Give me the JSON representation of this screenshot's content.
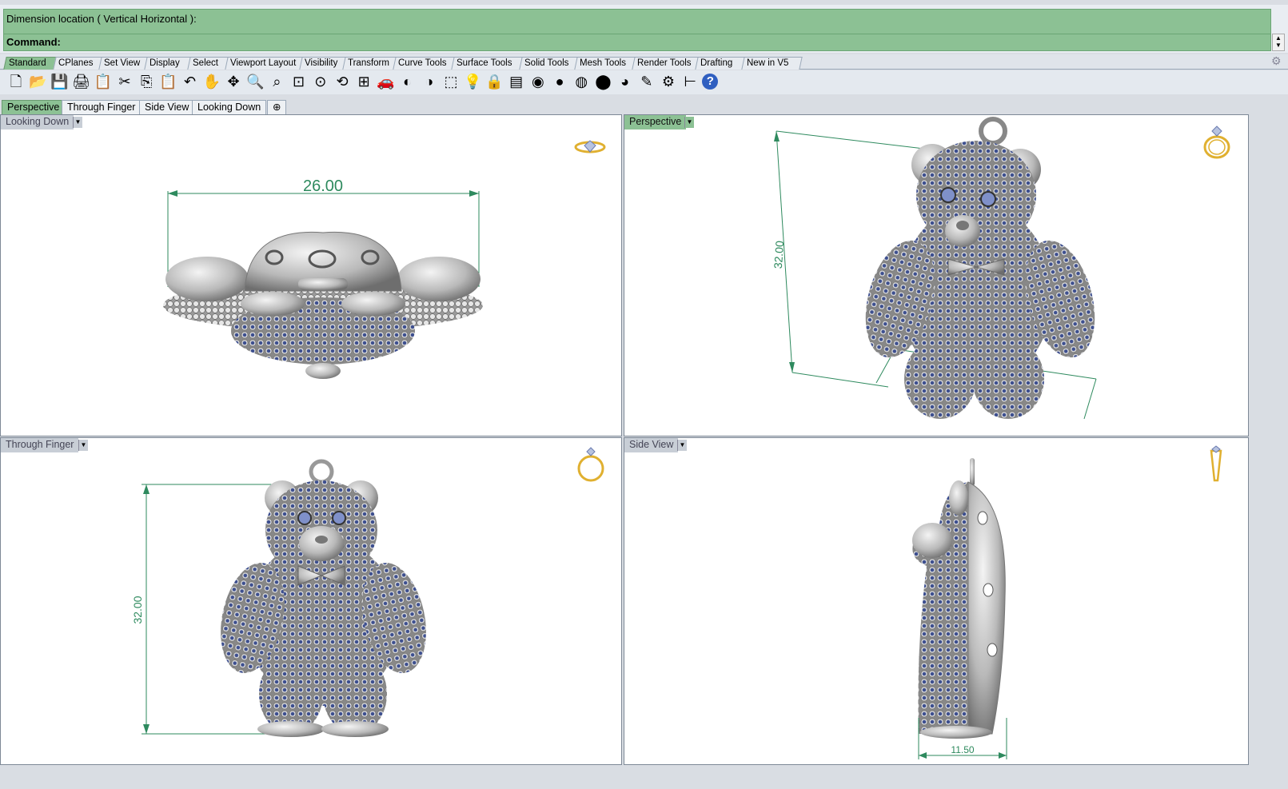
{
  "command": {
    "history": "Dimension location ( Vertical  Horizontal ):",
    "prompt": "Command:"
  },
  "toolbar_tabs": [
    {
      "label": "Standard",
      "active": true
    },
    {
      "label": "CPlanes"
    },
    {
      "label": "Set View"
    },
    {
      "label": "Display"
    },
    {
      "label": "Select"
    },
    {
      "label": "Viewport Layout"
    },
    {
      "label": "Visibility"
    },
    {
      "label": "Transform"
    },
    {
      "label": "Curve Tools"
    },
    {
      "label": "Surface Tools"
    },
    {
      "label": "Solid Tools"
    },
    {
      "label": "Mesh Tools"
    },
    {
      "label": "Render Tools"
    },
    {
      "label": "Drafting"
    },
    {
      "label": "New in V5"
    }
  ],
  "toolbar_icons": [
    "new-file-icon",
    "open-file-icon",
    "save-icon",
    "print-icon",
    "copy-to-clipboard-icon",
    "cut-icon",
    "copy-icon",
    "paste-icon",
    "undo-icon",
    "pan-icon",
    "move-view-icon",
    "zoom-icon",
    "zoom-window-icon",
    "zoom-extents-icon",
    "zoom-selected-icon",
    "rotate-view-icon",
    "four-viewports-icon",
    "car-icon",
    "hide-icon",
    "show-icon",
    "select-icon",
    "light-icon",
    "lock-icon",
    "layer-icon",
    "color-wheel-icon",
    "shade-icon",
    "render-preview-icon",
    "render-icon",
    "render-sphere-icon",
    "highlight-icon",
    "settings-icon",
    "snap-icon",
    "help-icon"
  ],
  "viewport_tabs": [
    {
      "label": "Perspective",
      "active": true
    },
    {
      "label": "Through Finger"
    },
    {
      "label": "Side View"
    },
    {
      "label": "Looking Down"
    }
  ],
  "viewports": {
    "top_left": {
      "title": "Looking Down",
      "dimension": "26.00",
      "active": false
    },
    "top_right": {
      "title": "Perspective",
      "dimension": "32.00",
      "active": true
    },
    "bottom_left": {
      "title": "Through Finger",
      "dimension": "32.00",
      "active": false
    },
    "bottom_right": {
      "title": "Side View",
      "dimension": "11.50",
      "active": false
    }
  },
  "colors": {
    "command_green": "#8cc194",
    "dimension_green": "#2e8a5e",
    "ring_gold": "#e0b030",
    "gem_blue": "#3d4f8f",
    "bead_silver": "#c8c8c8"
  }
}
